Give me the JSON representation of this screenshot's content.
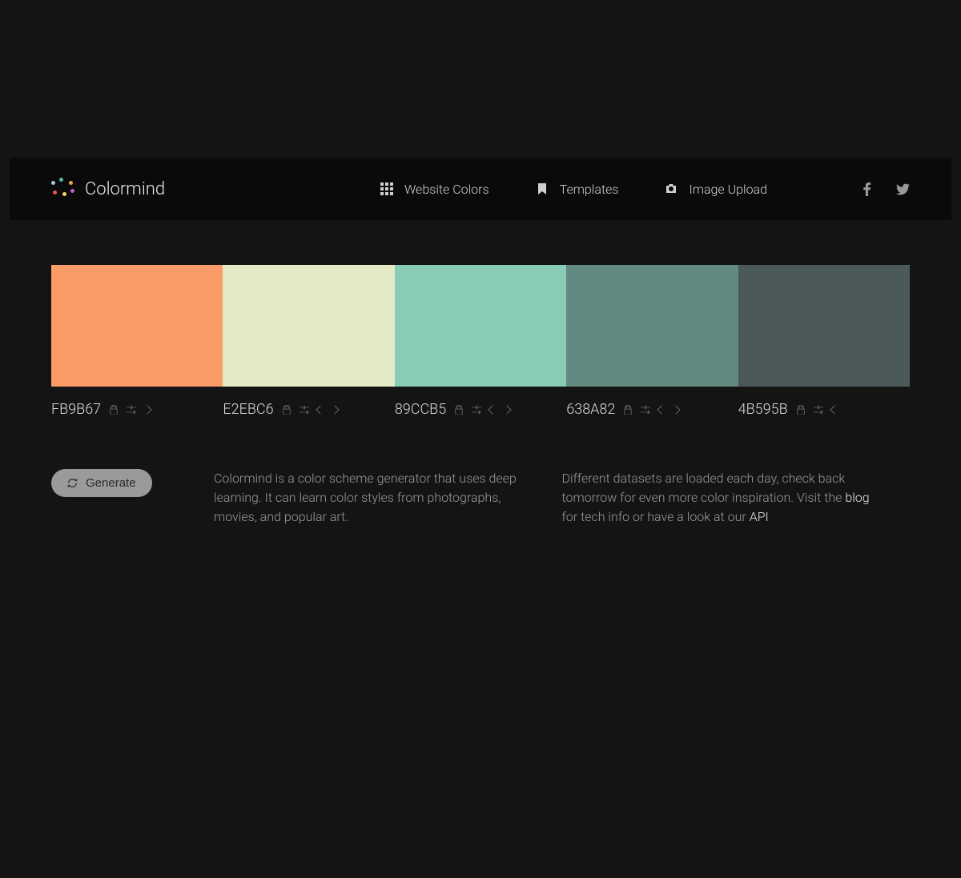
{
  "brand": {
    "name": "Colormind"
  },
  "nav": {
    "website_colors": "Website Colors",
    "templates": "Templates",
    "image_upload": "Image Upload"
  },
  "palette": [
    {
      "hex": "FB9B67",
      "color": "#FB9B67",
      "show_left": false,
      "show_right": true
    },
    {
      "hex": "E2EBC6",
      "color": "#E2EBC6",
      "show_left": true,
      "show_right": true
    },
    {
      "hex": "89CCB5",
      "color": "#89CCB5",
      "show_left": true,
      "show_right": true
    },
    {
      "hex": "638A82",
      "color": "#638A82",
      "show_left": true,
      "show_right": true
    },
    {
      "hex": "4B595B",
      "color": "#4B595B",
      "show_left": true,
      "show_right": false
    }
  ],
  "generate_label": "Generate",
  "desc1": "Colormind is a color scheme generator that uses deep learning. It can learn color styles from photographs, movies, and popular art.",
  "desc2_a": "Different datasets are loaded each day, check back tomorrow for even more color inspiration. Visit the ",
  "desc2_blog": "blog",
  "desc2_b": " for tech info or have a look at our ",
  "desc2_api": "API"
}
